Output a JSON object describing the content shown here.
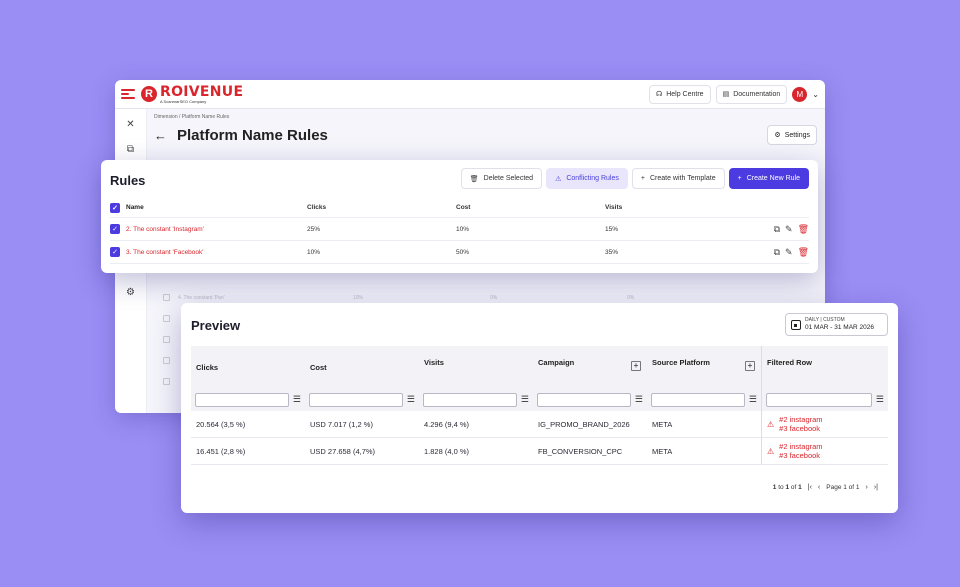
{
  "app": {
    "brand": "ROIVENUE",
    "brand_sub": "A ScanmarSEO Company",
    "help_label": "Help Centre",
    "docs_label": "Documentation",
    "avatar_initial": "M",
    "breadcrumb": "Dimension / Platform Name Rules",
    "page_title": "Platform Name Rules",
    "settings_label": "Settings",
    "ghost_rows": [
      {
        "name": "4. The constant 'Pan'",
        "clicks": "10%",
        "cost": "0%",
        "visits": "0%"
      }
    ]
  },
  "rules": {
    "title": "Rules",
    "actions": {
      "delete": "Delete Selected",
      "conflicting": "Conflicting Rules",
      "template": "Create with Template",
      "create": "Create New Rule"
    },
    "columns": [
      "Name",
      "Clicks",
      "Cost",
      "Visits"
    ],
    "rows": [
      {
        "name": "2. The constant 'Instagram'",
        "clicks": "25%",
        "cost": "10%",
        "visits": "15%"
      },
      {
        "name": "3. The constant 'Facebook'",
        "clicks": "10%",
        "cost": "50%",
        "visits": "35%"
      }
    ]
  },
  "preview": {
    "title": "Preview",
    "date_kind": "DAILY | CUSTOM",
    "date_range": "01 MAR - 31 MAR 2026",
    "columns": [
      "Clicks",
      "Cost",
      "Visits",
      "Campaign",
      "Source Platform",
      "Filtered Row"
    ],
    "rows": [
      {
        "clicks": "20.564 (3,5 %)",
        "cost": "USD 7.017 (1,2 %)",
        "visits": "4.296 (9,4 %)",
        "campaign": "IG_PROMO_BRAND_2026",
        "platform": "META",
        "filtered": [
          "#2 instagram",
          "#3 facebook"
        ]
      },
      {
        "clicks": "16.451 (2,8 %)",
        "cost": "USD 27.658 (4,7%)",
        "visits": "1.828 (4,0 %)",
        "campaign": "FB_CONVERSION_CPC",
        "platform": "META",
        "filtered": [
          "#2 instagram",
          "#3 facebook"
        ]
      }
    ],
    "pager": {
      "from": "1",
      "to_label": "to",
      "to": "1",
      "of_label": "of",
      "total": "1",
      "page_label": "Page 1 of 1"
    }
  },
  "colors": {
    "brand_red": "#d9262d",
    "accent": "#4c3be0",
    "background": "#9a8ef5"
  }
}
